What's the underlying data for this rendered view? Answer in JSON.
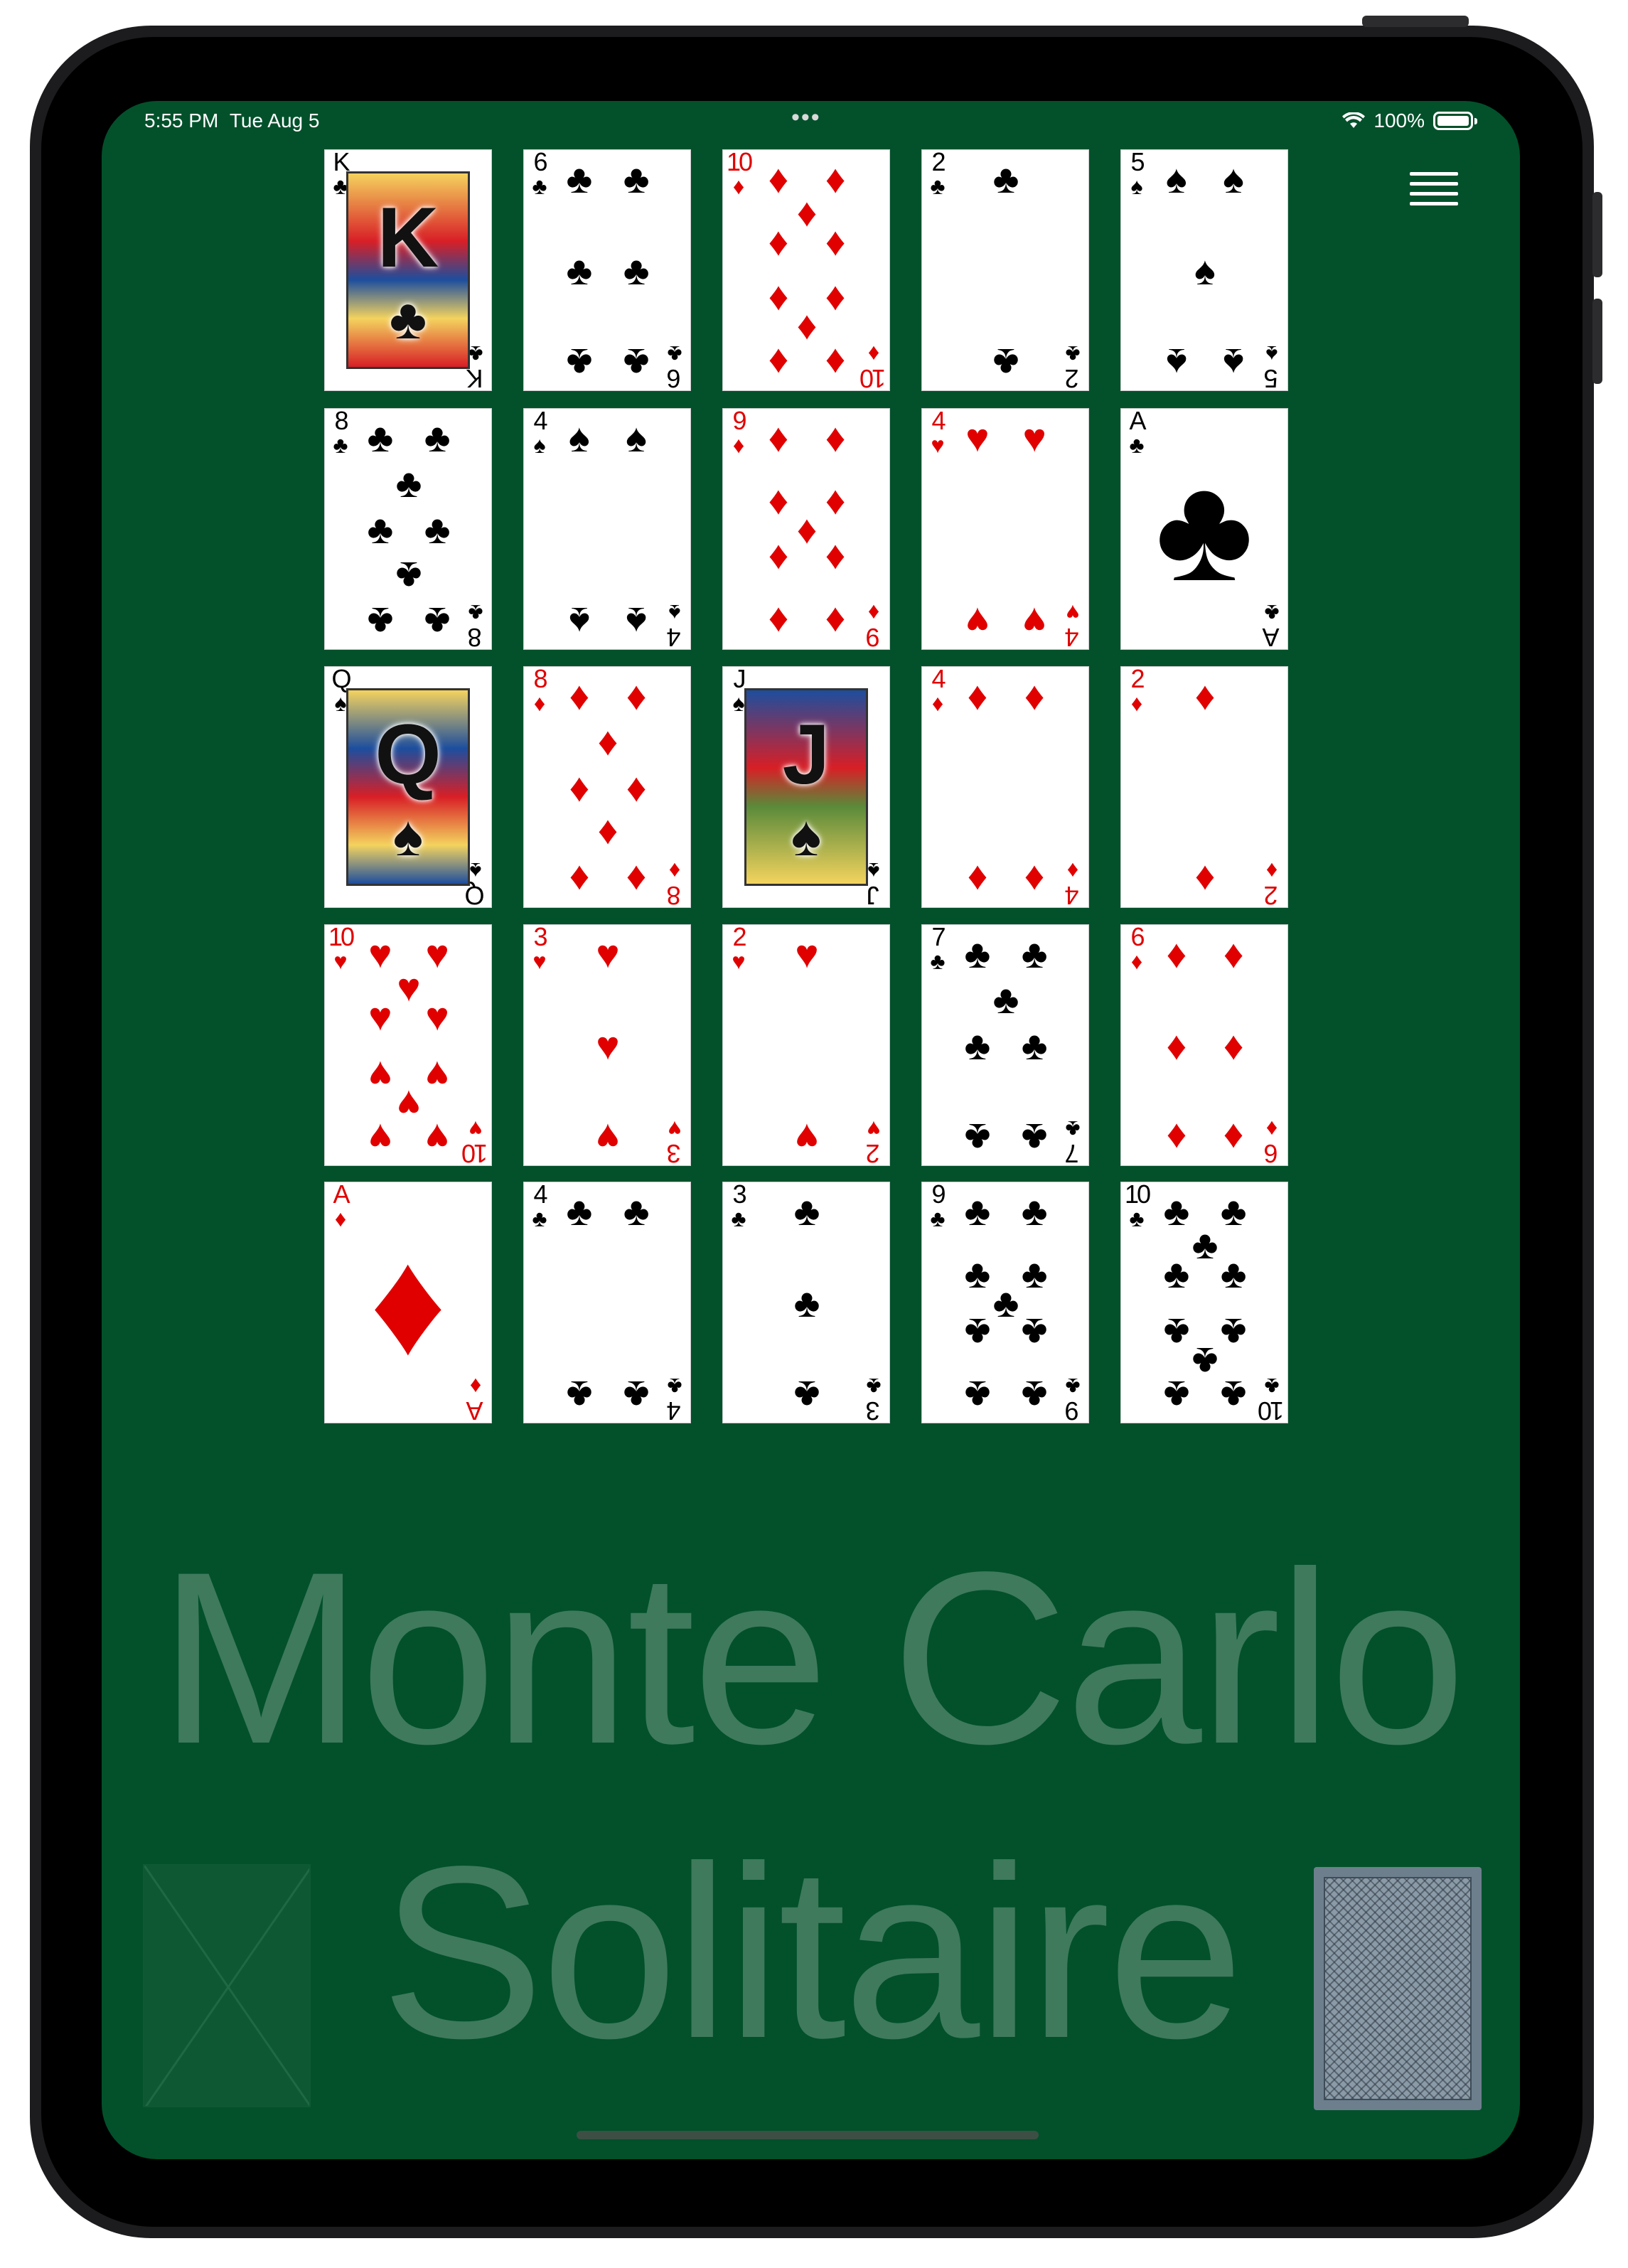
{
  "status_bar": {
    "time": "5:55 PM",
    "date": "Tue Aug 5",
    "dots": "•••",
    "battery": "100%"
  },
  "title": {
    "line1": "Monte Carlo",
    "line2": "Solitaire"
  },
  "colors": {
    "felt": "#02512b",
    "title": "#3f7a5d",
    "red_suit": "#e00000",
    "stock_back": "#6d7f8d"
  },
  "icons": {
    "menu": "hamburger-menu-icon",
    "wifi": "wifi-icon",
    "battery": "battery-icon"
  },
  "tableau": [
    [
      {
        "rank": "K",
        "suit": "♣"
      },
      {
        "rank": "6",
        "suit": "♣"
      },
      {
        "rank": "10",
        "suit": "♦"
      },
      {
        "rank": "2",
        "suit": "♣"
      },
      {
        "rank": "5",
        "suit": "♠"
      }
    ],
    [
      {
        "rank": "8",
        "suit": "♣"
      },
      {
        "rank": "4",
        "suit": "♠"
      },
      {
        "rank": "9",
        "suit": "♦"
      },
      {
        "rank": "4",
        "suit": "♥"
      },
      {
        "rank": "A",
        "suit": "♣"
      }
    ],
    [
      {
        "rank": "Q",
        "suit": "♠"
      },
      {
        "rank": "8",
        "suit": "♦"
      },
      {
        "rank": "J",
        "suit": "♠"
      },
      {
        "rank": "4",
        "suit": "♦"
      },
      {
        "rank": "2",
        "suit": "♦"
      }
    ],
    [
      {
        "rank": "10",
        "suit": "♥"
      },
      {
        "rank": "3",
        "suit": "♥"
      },
      {
        "rank": "2",
        "suit": "♥"
      },
      {
        "rank": "7",
        "suit": "♣"
      },
      {
        "rank": "6",
        "suit": "♦"
      }
    ],
    [
      {
        "rank": "A",
        "suit": "♦"
      },
      {
        "rank": "4",
        "suit": "♣"
      },
      {
        "rank": "3",
        "suit": "♣"
      },
      {
        "rank": "9",
        "suit": "♣"
      },
      {
        "rank": "10",
        "suit": "♣"
      }
    ]
  ]
}
